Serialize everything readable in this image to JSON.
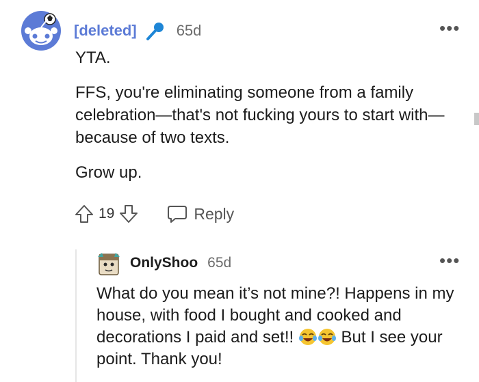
{
  "comment": {
    "username": "[deleted]",
    "time": "65d",
    "more_label": "•••",
    "paragraphs": [
      "YTA.",
      "FFS, you're eliminating someone from a family celebration—that's not fucking yours to start with—because of two texts.",
      "Grow up."
    ],
    "votes": "19",
    "reply_label": "Reply",
    "colors": {
      "username": "#5c7bd6",
      "avatar_bg": "#5c7bd6",
      "mic": "#1e86d6"
    }
  },
  "reply": {
    "username": "OnlyShoo",
    "time": "65d",
    "more_label": "•••",
    "text_before_emoji": "What do you mean it’s not mine?! Happens in my house, with food I bought and cooked and decorations I paid and set!! ",
    "text_after_emoji": " But I see your point. Thank you!",
    "emoji_names": [
      "joy-emoji",
      "joy-emoji"
    ]
  },
  "icons": {
    "avatar_deleted": "snoo-avatar-icon",
    "mic": "microphone-icon",
    "upvote": "upvote-arrow-icon",
    "downvote": "downvote-arrow-icon",
    "reply": "speech-bubble-icon",
    "more": "more-dots-icon"
  }
}
